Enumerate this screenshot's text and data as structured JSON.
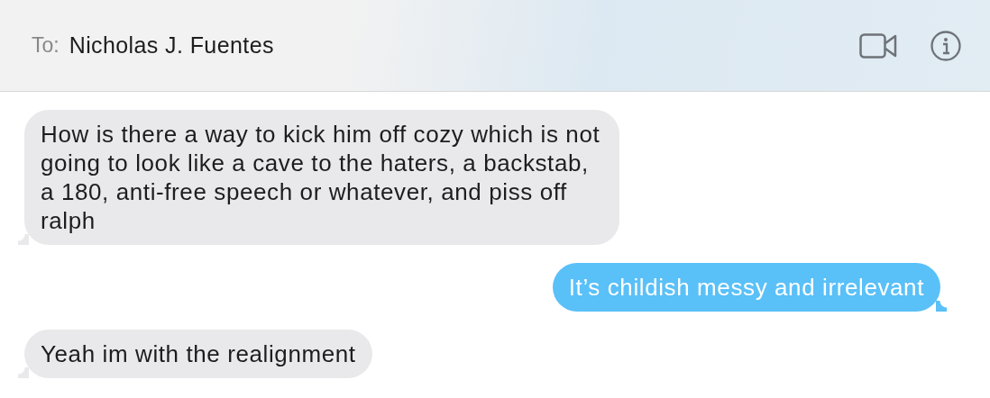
{
  "header": {
    "to_label": "To:",
    "recipient": "Nicholas J. Fuentes"
  },
  "messages": [
    {
      "kind": "incoming",
      "text": "How is there a way to kick him off cozy which is not going to look like a cave to the haters, a backstab, a 180, anti-free speech or whatever, and piss off ralph"
    },
    {
      "kind": "outgoing",
      "text": "It’s childish messy and irrelevant"
    },
    {
      "kind": "incoming",
      "text": "Yeah im with the realignment"
    }
  ]
}
